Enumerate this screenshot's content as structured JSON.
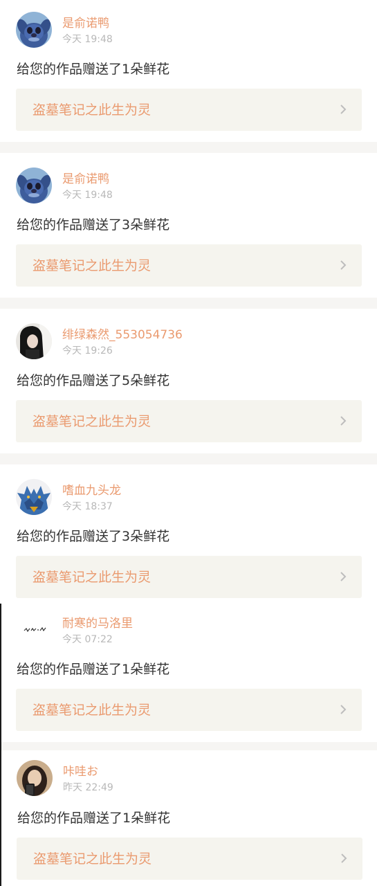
{
  "notifications": [
    {
      "avatar": "stitch-avatar",
      "username": "是俞诺鸭",
      "time": "今天 19:48",
      "message": "给您的作品赠送了1朵鲜花",
      "work_title": "盗墓笔记之此生为灵"
    },
    {
      "avatar": "stitch-avatar",
      "username": "是俞诺鸭",
      "time": "今天 19:48",
      "message": "给您的作品赠送了3朵鲜花",
      "work_title": "盗墓笔记之此生为灵"
    },
    {
      "avatar": "girl-portrait-avatar",
      "username": "绯绿森然_553054736",
      "time": "今天 19:26",
      "message": "给您的作品赠送了5朵鲜花",
      "work_title": "盗墓笔记之此生为灵"
    },
    {
      "avatar": "dragon-avatar",
      "username": "嗜血九头龙",
      "time": "今天 18:37",
      "message": "给您的作品赠送了3朵鲜花",
      "work_title": "盗墓笔记之此生为灵"
    },
    {
      "avatar": "handwriting-avatar",
      "username": "耐寒的马洛里",
      "time": "今天 07:22",
      "message": "给您的作品赠送了1朵鲜花",
      "work_title": "盗墓笔记之此生为灵"
    },
    {
      "avatar": "selfie-avatar",
      "username": "咔哇お",
      "time": "昨天 22:49",
      "message": "给您的作品赠送了1朵鲜花",
      "work_title": "盗墓笔记之此生为灵"
    }
  ],
  "colors": {
    "accent": "#ea9a6f",
    "timestamp": "#b8b8b8",
    "message": "#333333",
    "card_bg": "#f5f4ee",
    "separator": "#f6f5f3",
    "chevron": "#bdbdbd"
  },
  "icons": {
    "chevron": "chevron-right-icon"
  }
}
